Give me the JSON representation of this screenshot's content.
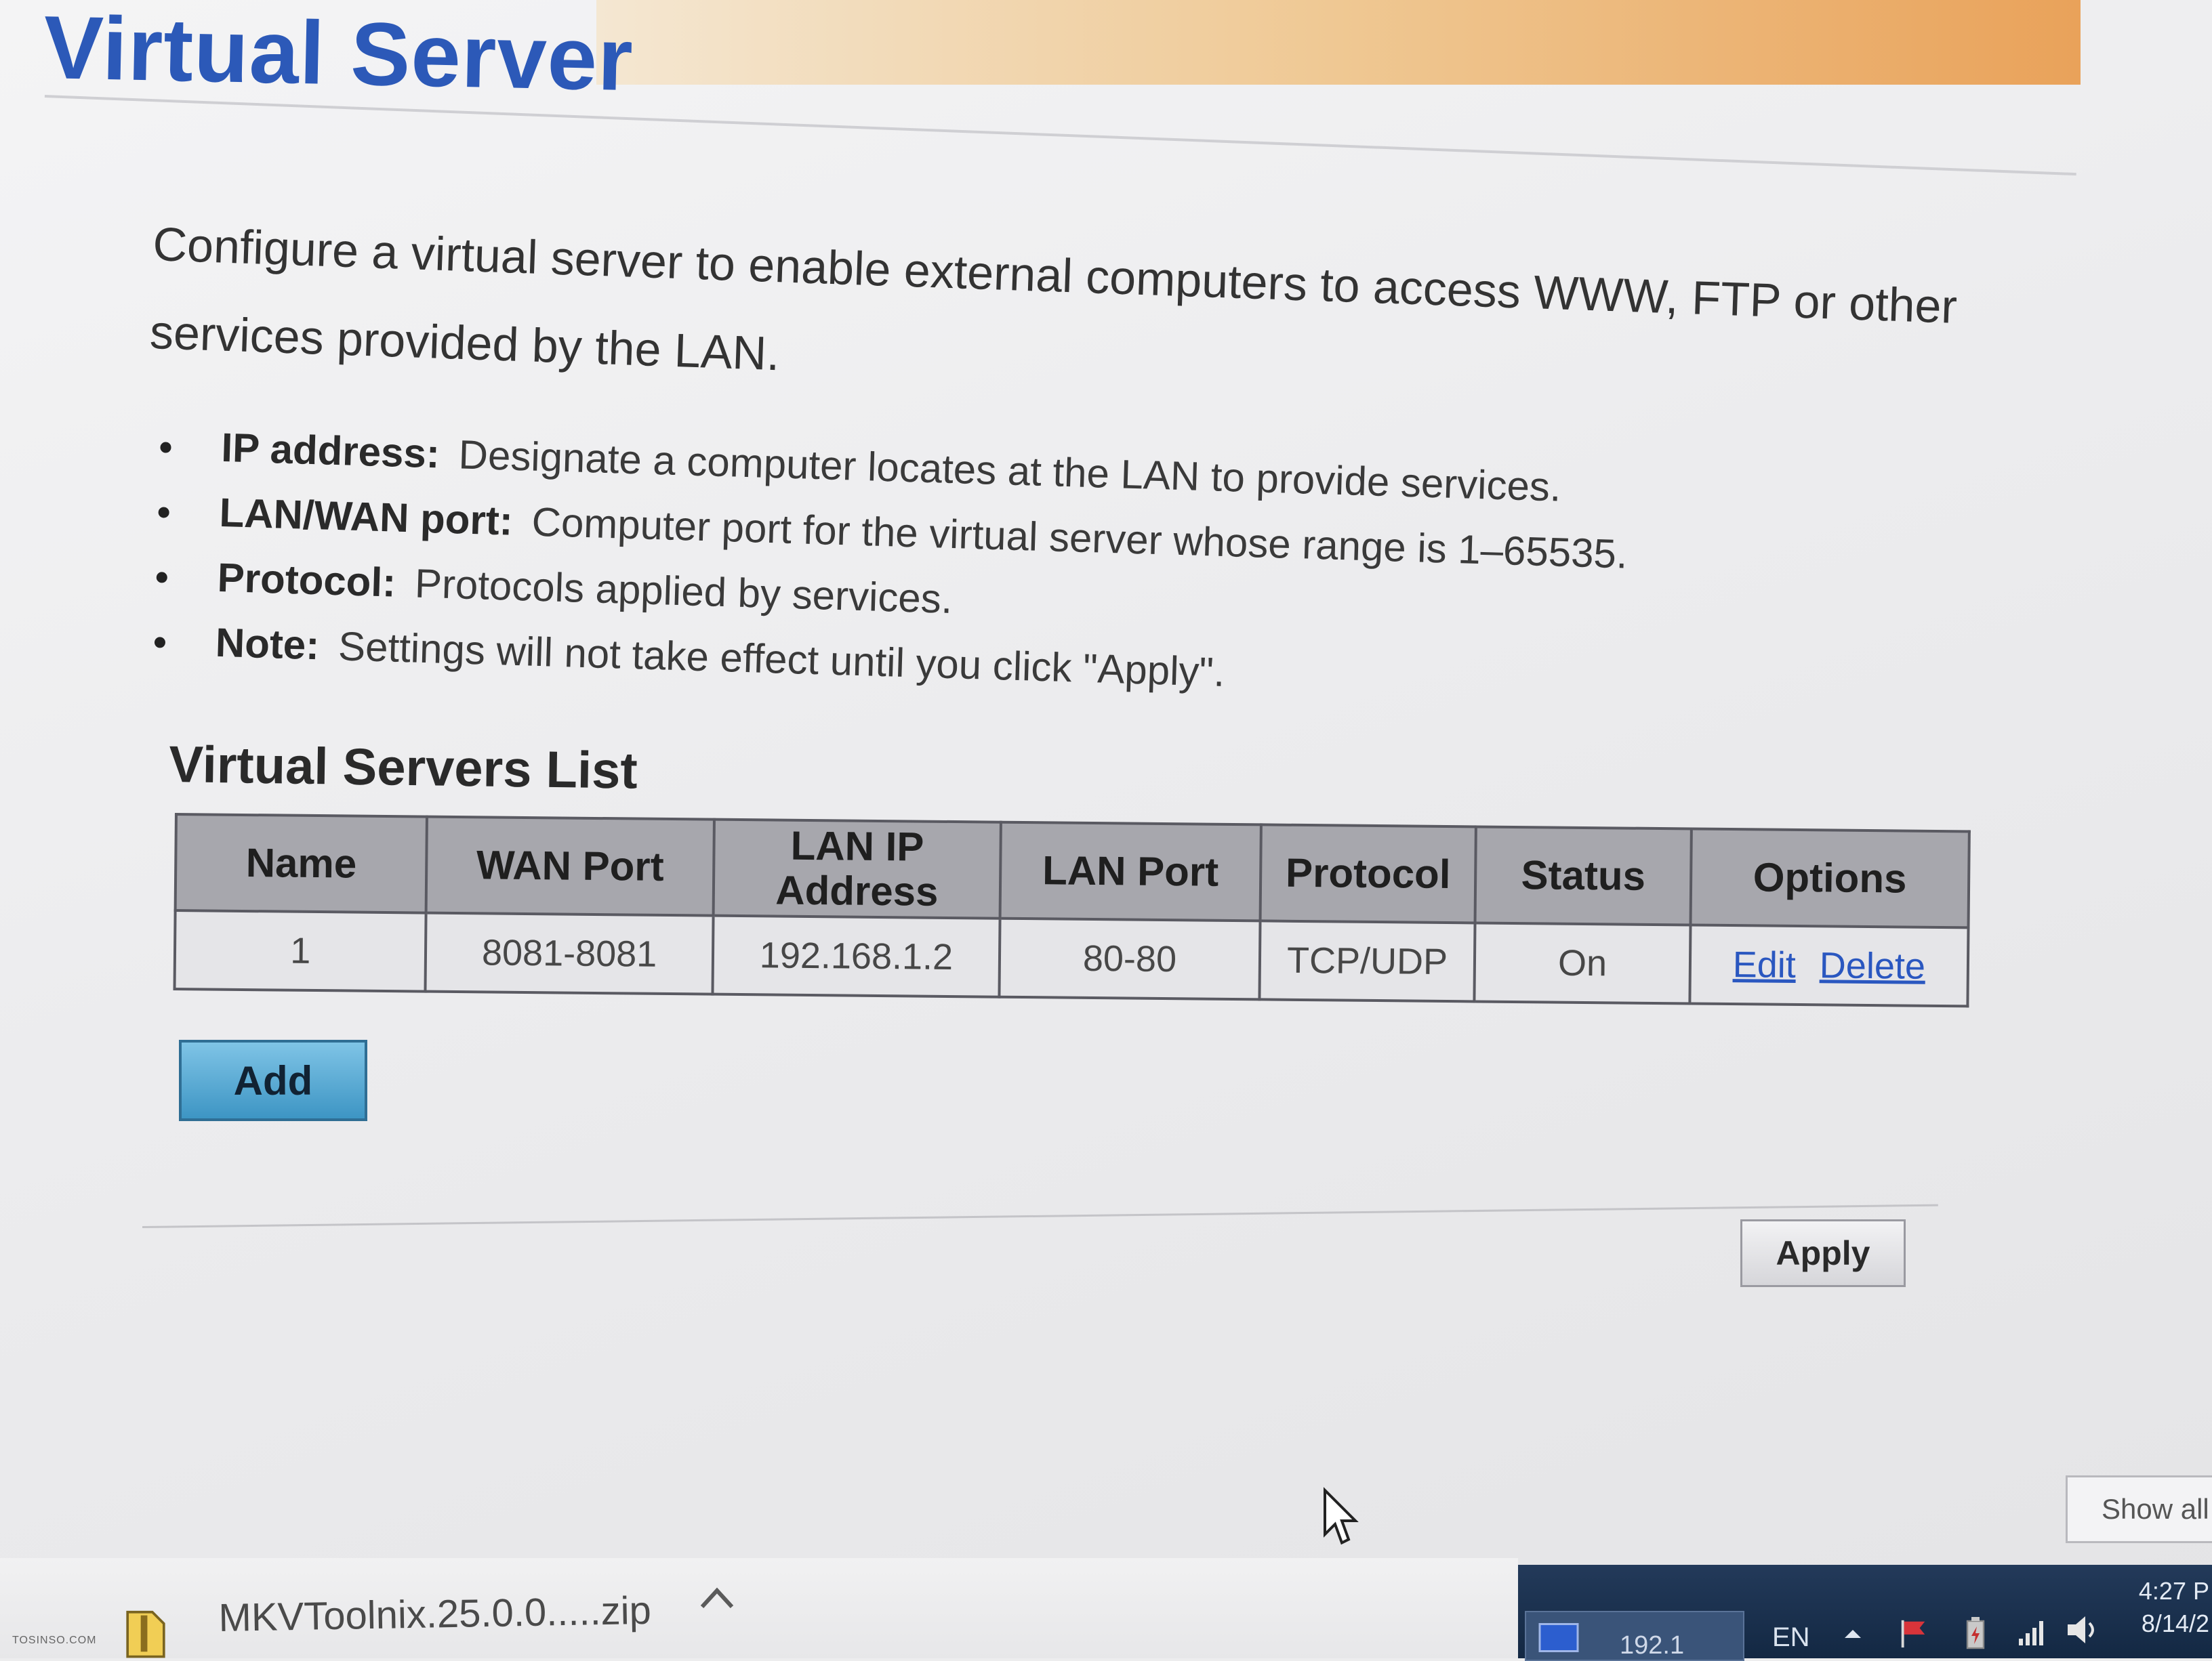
{
  "page": {
    "title": "Virtual Server",
    "intro": "Configure a virtual server to enable external computers to access WWW, FTP or other services provided by the LAN.",
    "bullets": [
      {
        "label": "IP address:",
        "text": "Designate a computer locates at the LAN to provide services."
      },
      {
        "label": "LAN/WAN port:",
        "text": "Computer port for the virtual server whose range is 1–65535."
      },
      {
        "label": "Protocol:",
        "text": "Protocols applied by services."
      },
      {
        "label": "Note:",
        "text": "Settings will not take effect until you click \"Apply\"."
      }
    ]
  },
  "servers_list": {
    "title": "Virtual Servers List",
    "headers": [
      "Name",
      "WAN Port",
      "LAN IP Address",
      "LAN Port",
      "Protocol",
      "Status",
      "Options"
    ],
    "rows": [
      {
        "name": "1",
        "wan_port": "8081-8081",
        "lan_ip": "192.168.1.2",
        "lan_port": "80-80",
        "protocol": "TCP/UDP",
        "status": "On",
        "edit": "Edit",
        "delete": "Delete"
      }
    ],
    "add_label": "Add",
    "apply_label": "Apply"
  },
  "downloads": {
    "file": "MKVToolnix.25.0.0.....zip",
    "show_all": "Show all"
  },
  "taskbar": {
    "app_label": "192.1",
    "lang": "EN",
    "clock_time": "4:27 P",
    "clock_date": "8/14/2"
  },
  "watermark": "TOSINSO.COM",
  "colors": {
    "title": "#2c59b8",
    "link": "#2a57c0",
    "header_bg": "#a7a7ad",
    "add_button": "#3d95c4",
    "taskbar": "#132843"
  },
  "icons": [
    "cursor-arrow-icon",
    "zip-file-icon",
    "chevron-up-icon",
    "flag-icon",
    "power-icon",
    "signal-icon",
    "volume-icon"
  ]
}
